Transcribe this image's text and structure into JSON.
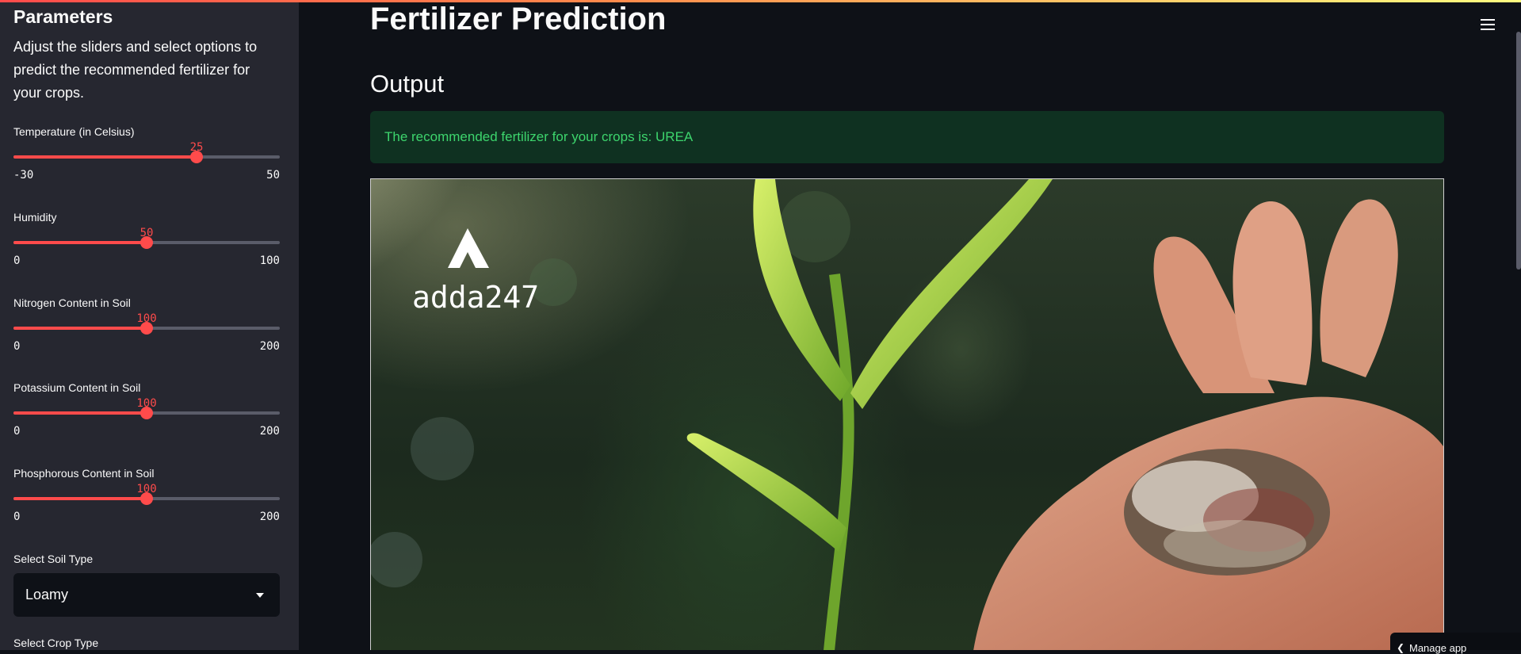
{
  "sidebar": {
    "title": "Parameters",
    "description": "Adjust the sliders and select options to predict the recommended fertilizer for your crops.",
    "sliders": [
      {
        "label": "Temperature (in Celsius)",
        "value": "25",
        "min": "-30",
        "max": "50",
        "fraction": 0.6875
      },
      {
        "label": "Humidity",
        "value": "50",
        "min": "0",
        "max": "100",
        "fraction": 0.5
      },
      {
        "label": "Nitrogen Content in Soil",
        "value": "100",
        "min": "0",
        "max": "200",
        "fraction": 0.5
      },
      {
        "label": "Potassium Content in Soil",
        "value": "100",
        "min": "0",
        "max": "200",
        "fraction": 0.5
      },
      {
        "label": "Phosphorous Content in Soil",
        "value": "100",
        "min": "0",
        "max": "200",
        "fraction": 0.5
      }
    ],
    "soil_type": {
      "label": "Select Soil Type",
      "value": "Loamy"
    },
    "crop_type": {
      "label": "Select Crop Type"
    }
  },
  "main": {
    "title": "Fertilizer Prediction",
    "output_heading": "Output",
    "result_text": "The recommended fertilizer for your crops is: UREA",
    "image": {
      "logo_text": "adda247"
    }
  },
  "footer": {
    "manage_app": "Manage app"
  },
  "colors": {
    "accent": "#ff4b4b",
    "success_text": "#3dd56d",
    "sidebar_bg": "#262730",
    "app_bg": "#0e1117"
  },
  "icons": {
    "menu": "hamburger-icon",
    "caret": "chevron-down-icon"
  }
}
